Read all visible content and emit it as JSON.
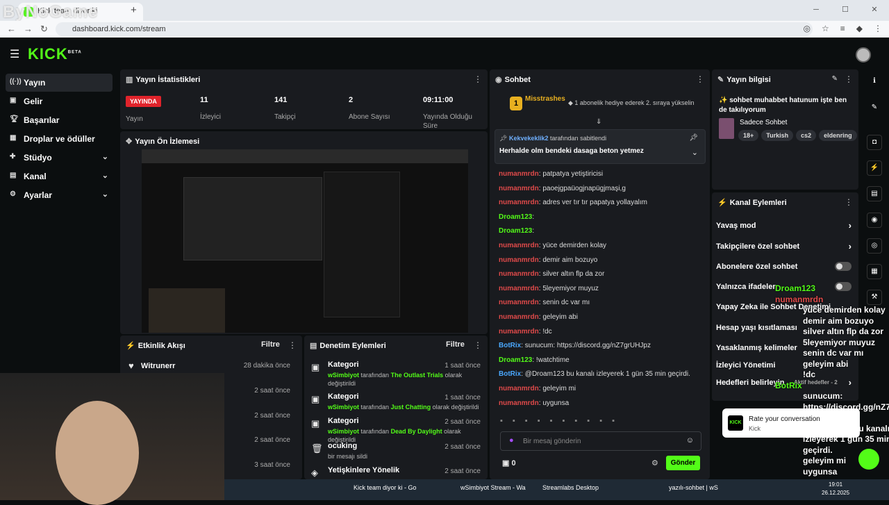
{
  "browser": {
    "tab_title": "Kick team diyor ki",
    "url": "dashboard.kick.com/stream",
    "watermark": "ByNoGame"
  },
  "kick": {
    "logo": "KICK",
    "logo_beta": "BETA"
  },
  "sidebar": {
    "items": [
      {
        "label": "Yayın",
        "icon": "broadcast-icon",
        "active": true
      },
      {
        "label": "Gelir",
        "icon": "revenue-icon"
      },
      {
        "label": "Başarılar",
        "icon": "trophy-icon"
      },
      {
        "label": "Droplar ve ödüller",
        "icon": "gift-icon"
      },
      {
        "label": "Stüdyo",
        "icon": "studio-icon"
      },
      {
        "label": "Kanal",
        "icon": "channel-icon"
      },
      {
        "label": "Ayarlar",
        "icon": "gear-icon"
      }
    ]
  },
  "stats": {
    "title": "Yayın İstatistikleri",
    "live_badge": "YAYINDA",
    "live_label": "Yayın",
    "viewers": "11",
    "viewers_label": "İzleyici",
    "followers": "141",
    "followers_label": "Takipçi",
    "subs": "2",
    "subs_label": "Abone Sayısı",
    "duration": "09:11:00",
    "duration_label": "Yayında Olduğu Süre"
  },
  "preview": {
    "title": "Yayın Ön İzlemesi"
  },
  "activity": {
    "title": "Etkinlik Akışı",
    "filter": "Filtre",
    "items": [
      {
        "name": "Witrunerr",
        "time": "28 dakika önce"
      },
      {
        "name": "",
        "time": "2 saat önce"
      },
      {
        "name": "",
        "time": "2 saat önce"
      },
      {
        "name": "",
        "time": "2 saat önce"
      },
      {
        "name": "",
        "time": "3 saat önce"
      }
    ]
  },
  "moderation": {
    "title": "Denetim Eylemleri",
    "filter": "Filtre",
    "items": [
      {
        "title": "Kategori",
        "time": "1 saat önce",
        "by": "wSimbiyot",
        "mid": "tarafından",
        "value": "The Outlast Trials",
        "end": "olarak değiştirildi"
      },
      {
        "title": "Kategori",
        "time": "1 saat önce",
        "by": "wSimbiyot",
        "mid": "tarafından",
        "value": "Just Chatting",
        "end": "olarak değiştirildi"
      },
      {
        "title": "Kategori",
        "time": "2 saat önce",
        "by": "wSimbiyot",
        "mid": "tarafından",
        "value": "Dead By Daylight",
        "end": "olarak değiştirildi"
      },
      {
        "title": "ocuking",
        "time": "2 saat önce",
        "sub": "bir mesajı sildi"
      },
      {
        "title": "Yetişkinlere Yönelik",
        "time": "2 saat önce"
      }
    ]
  },
  "chat": {
    "title": "Sohbet",
    "top_user": "Misstrashes",
    "top_rank": "1",
    "top_note": "1 abonelik hediye ederek 2. sıraya yükselin",
    "pinned_by": "Kekvekeklik2",
    "pinned_suffix": "tarafından sabitlendi",
    "pinned_text": "Herhalde olm bendeki dasaga beton yetmez",
    "messages": [
      {
        "user": "numanmrdn",
        "color": "red",
        "text": "patpatya yetiştiricisi"
      },
      {
        "user": "numanmrdn",
        "color": "red",
        "text": "paoejgpaüogjnapügjmaşi,g"
      },
      {
        "user": "numanmrdn",
        "color": "red",
        "text": "adres ver tır tır papatya yollayalım"
      },
      {
        "user": "Droam123",
        "color": "green",
        "text": ""
      },
      {
        "user": "Droam123",
        "color": "green",
        "text": ""
      },
      {
        "user": "numanmrdn",
        "color": "red",
        "text": "yüce demirden kolay"
      },
      {
        "user": "numanmrdn",
        "color": "red",
        "text": "demir aim bozuyo"
      },
      {
        "user": "numanmrdn",
        "color": "red",
        "text": "silver altın flp da zor"
      },
      {
        "user": "numanmrdn",
        "color": "red",
        "text": "5leyemiyor muyuz"
      },
      {
        "user": "numanmrdn",
        "color": "red",
        "text": "senin dc var mı"
      },
      {
        "user": "numanmrdn",
        "color": "red",
        "text": "geleyim abi"
      },
      {
        "user": "numanmrdn",
        "color": "red",
        "text": "!dc"
      },
      {
        "user": "BotRix",
        "color": "blue",
        "text": "sunucum: https://discord.gg/nZ7grUHJpz"
      },
      {
        "user": "Droam123",
        "color": "green",
        "text": "!watchtime"
      },
      {
        "user": "BotRix",
        "color": "blue",
        "text": "@Droam123 bu kanalı izleyerek 1 gün 35 min geçirdi."
      },
      {
        "user": "numanmrdn",
        "color": "red",
        "text": "geleyim mi"
      },
      {
        "user": "numanmrdn",
        "color": "red",
        "text": "uygunsa"
      }
    ],
    "placeholder": "Bir mesaj gönderin",
    "points": "0",
    "send": "Gönder"
  },
  "stream_info": {
    "title": "Yayın bilgisi",
    "stream_title": "✨ sohbet muhabbet hatunum işte ben de takılıyorum",
    "category": "Sadece Sohbet",
    "tags": [
      "18+",
      "Turkish",
      "cs2",
      "eldenring"
    ]
  },
  "channel_actions": {
    "title": "Kanal Eylemleri",
    "items": [
      {
        "label": "Yavaş mod",
        "kind": "arrow"
      },
      {
        "label": "Takipçilere özel sohbet",
        "kind": "arrow"
      },
      {
        "label": "Abonelere özel sohbet",
        "kind": "toggle"
      },
      {
        "label": "Yalnızca ifadeler",
        "kind": "toggle"
      },
      {
        "label": "Yapay Zeka ile Sohbet Denetimi",
        "kind": "ext"
      },
      {
        "label": "Hesap yaşı kısıtlaması",
        "kind": "arrow"
      },
      {
        "label": "Yasaklanmış kelimeler",
        "kind": "arrow"
      },
      {
        "label": "İzleyici Yönetimi",
        "kind": "arrow"
      },
      {
        "label": "Hedefleri belirleyin",
        "kind": "arrow",
        "extra": "Aktif hedefler - 2"
      }
    ]
  },
  "overlay": {
    "lines": [
      {
        "text": "Droam123",
        "c": "g"
      },
      {
        "text": "numanmrdn",
        "c": "r"
      },
      {
        "text": "yüce demirden kolay",
        "c": "w"
      },
      {
        "text": "demir aim bozuyo",
        "c": "w"
      },
      {
        "text": "silver altın flp da zor",
        "c": "w"
      },
      {
        "text": "5leyemiyor muyuz",
        "c": "w"
      },
      {
        "text": "senin dc var mı",
        "c": "w"
      },
      {
        "text": "geleyim abi",
        "c": "w"
      },
      {
        "text": "!dc",
        "c": "w"
      },
      {
        "text": "BotRix",
        "c": "g"
      },
      {
        "text": "sunucum:",
        "c": "w"
      },
      {
        "text": "https://discord.gg/nZ7",
        "c": "w"
      },
      {
        "text": "BotRix",
        "c": "g"
      },
      {
        "text": "@Droam123 bu kanalı",
        "c": "w"
      },
      {
        "text": "izleyerek 1 gün 35 min",
        "c": "w"
      },
      {
        "text": "geçirdi.",
        "c": "w"
      },
      {
        "text": "geleyim mi",
        "c": "w"
      },
      {
        "text": "uygunsa",
        "c": "w"
      }
    ],
    "toast_title": "Rate your conversation",
    "toast_sub": "Kick"
  },
  "taskbar": {
    "items": [
      "Kick team diyor ki - Go",
      "wSimbiyot Stream - Wa",
      "Streamlabs Desktop",
      "yazılı-sohbet | wS"
    ],
    "time": "19:01",
    "date": "26.12.2025"
  },
  "colors": {
    "accent": "#53fc18",
    "live": "#e0232b",
    "panel": "#191b1f",
    "bg": "#0b0e0f"
  }
}
